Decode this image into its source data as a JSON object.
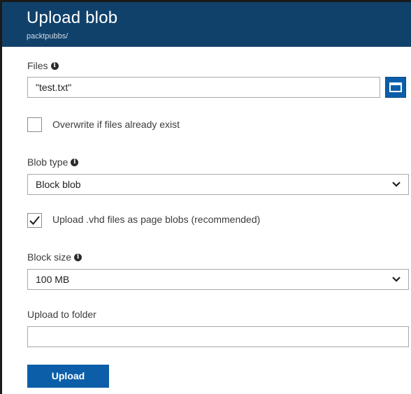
{
  "header": {
    "title": "Upload blob",
    "subtitle": "packtpubbs/"
  },
  "files": {
    "label": "Files",
    "value": "\"test.txt\"",
    "browse_icon": "folder-icon"
  },
  "overwrite": {
    "label": "Overwrite if files already exist",
    "checked": false
  },
  "blob_type": {
    "label": "Blob type",
    "selected": "Block blob"
  },
  "vhd_page_blobs": {
    "label": "Upload .vhd files as page blobs (recommended)",
    "checked": true
  },
  "block_size": {
    "label": "Block size",
    "selected": "100 MB"
  },
  "upload_folder": {
    "label": "Upload to folder",
    "value": ""
  },
  "actions": {
    "upload_label": "Upload"
  },
  "colors": {
    "header_bg": "#10416b",
    "accent": "#0c5ea8"
  }
}
